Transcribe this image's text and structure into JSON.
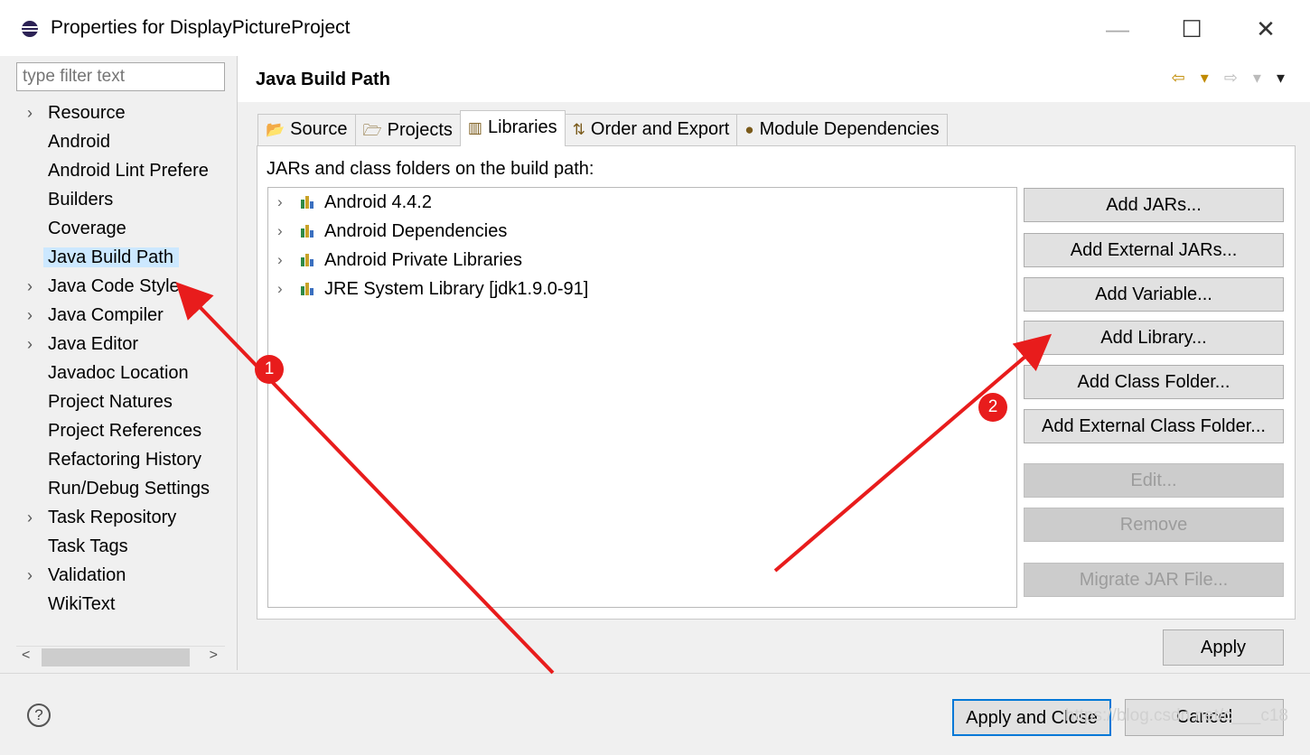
{
  "window": {
    "title": "Properties for DisplayPictureProject",
    "minimize_glyph": "—",
    "maximize_glyph": "☐",
    "close_glyph": "✕"
  },
  "filter": {
    "placeholder": "type filter text"
  },
  "nav": {
    "items": [
      {
        "label": "Resource",
        "expandable": true
      },
      {
        "label": "Android",
        "expandable": false
      },
      {
        "label": "Android Lint Prefere",
        "expandable": false
      },
      {
        "label": "Builders",
        "expandable": false
      },
      {
        "label": "Coverage",
        "expandable": false
      },
      {
        "label": "Java Build Path",
        "expandable": false,
        "selected": true
      },
      {
        "label": "Java Code Style",
        "expandable": true
      },
      {
        "label": "Java Compiler",
        "expandable": true
      },
      {
        "label": "Java Editor",
        "expandable": true
      },
      {
        "label": "Javadoc Location",
        "expandable": false
      },
      {
        "label": "Project Natures",
        "expandable": false
      },
      {
        "label": "Project References",
        "expandable": false
      },
      {
        "label": "Refactoring History",
        "expandable": false
      },
      {
        "label": "Run/Debug Settings",
        "expandable": false
      },
      {
        "label": "Task Repository",
        "expandable": true
      },
      {
        "label": "Task Tags",
        "expandable": false
      },
      {
        "label": "Validation",
        "expandable": true
      },
      {
        "label": "WikiText",
        "expandable": false
      }
    ],
    "scroll_left": "<",
    "scroll_right": ">"
  },
  "page": {
    "title": "Java Build Path",
    "history_back": "⇦ ▾",
    "history_forward": "⇨ ▾",
    "menu": "▾"
  },
  "tabs": [
    {
      "label": "Source",
      "icon": "source-folder-icon",
      "glyph": "📂",
      "active": false
    },
    {
      "label": "Projects",
      "icon": "projects-icon",
      "glyph": "🗁",
      "active": false
    },
    {
      "label": "Libraries",
      "icon": "libraries-icon",
      "glyph": "▥",
      "active": true
    },
    {
      "label": "Order and Export",
      "icon": "order-export-icon",
      "glyph": "⇅",
      "active": false
    },
    {
      "label": "Module Dependencies",
      "icon": "module-icon",
      "glyph": "●",
      "active": false
    }
  ],
  "libraries": {
    "heading": "JARs and class folders on the build path:",
    "entries": [
      "Android 4.4.2",
      "Android Dependencies",
      "Android Private Libraries",
      "JRE System Library [jdk1.9.0-91]"
    ],
    "buttons": {
      "add_jars": "Add JARs...",
      "add_external_jars": "Add External JARs...",
      "add_variable": "Add Variable...",
      "add_library": "Add Library...",
      "add_class_folder": "Add Class Folder...",
      "add_external_class_folder": "Add External Class Folder...",
      "edit": "Edit...",
      "remove": "Remove",
      "migrate_jar": "Migrate JAR File..."
    }
  },
  "apply_label": "Apply",
  "footer": {
    "help": "?",
    "apply_close": "Apply and Close",
    "cancel": "Cancel",
    "watermark": "https://blog.csdn.net/c___c18"
  },
  "annotations": {
    "badge1": "1",
    "badge2": "2",
    "arrow_color": "#e81c1c"
  }
}
